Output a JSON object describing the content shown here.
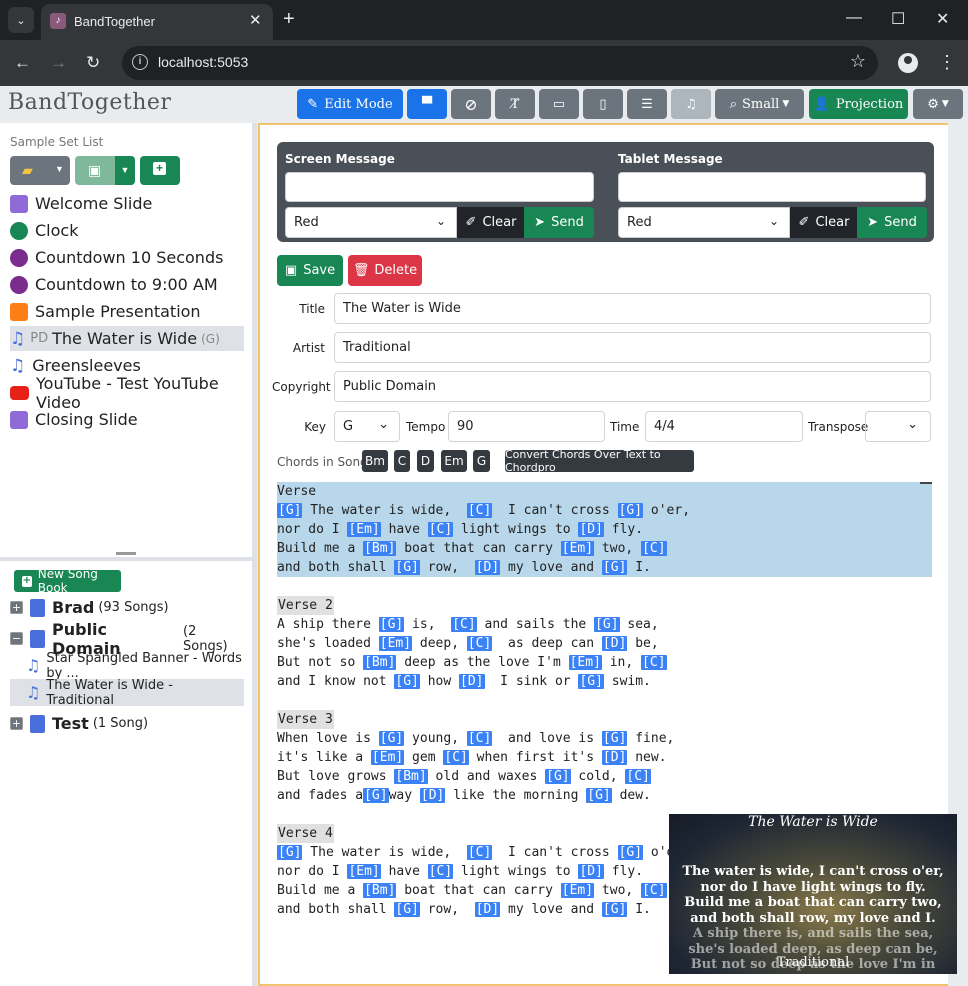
{
  "browser": {
    "tab_title": "BandTogether",
    "url": "localhost:5053"
  },
  "app": {
    "brand": "BandTogether",
    "toolbar": {
      "edit_mode": "Edit Mode",
      "search_size": "Small",
      "projection": "Projection"
    }
  },
  "sidebar": {
    "set_list_label": "Sample Set List",
    "slides": [
      {
        "label": "Welcome Slide",
        "icon": "image-icon",
        "color": "#8e6bd6"
      },
      {
        "label": "Clock",
        "icon": "clock-icon",
        "color": "#198754"
      },
      {
        "label": "Countdown 10 Seconds",
        "icon": "stopwatch-icon",
        "color": "#7b2d8e"
      },
      {
        "label": "Countdown to 9:00 AM",
        "icon": "stopwatch-icon",
        "color": "#7b2d8e"
      },
      {
        "label": "Sample Presentation",
        "icon": "presentation-icon",
        "color": "#fd7e14"
      },
      {
        "label": "The Water is Wide",
        "prefix": "PD",
        "suffix": "(G)",
        "icon": "music-icon",
        "color": "#4a6fdc"
      },
      {
        "label": "Greensleeves",
        "icon": "music-icon",
        "color": "#4a6fdc"
      },
      {
        "label": "YouTube - Test YouTube Video",
        "icon": "youtube-icon",
        "color": "#e62117"
      },
      {
        "label": "Closing Slide",
        "icon": "image-icon",
        "color": "#8e6bd6"
      }
    ],
    "new_song_book": "New Song Book",
    "books": [
      {
        "name": "Brad",
        "count": "(93 Songs)",
        "toggle": "+"
      },
      {
        "name": "Public Domain",
        "count": "(2 Songs)",
        "toggle": "−"
      },
      {
        "name": "Test",
        "count": "(1 Song)",
        "toggle": "+"
      }
    ],
    "songs": [
      "Star Spangled Banner - Words by ...",
      "The Water is Wide - Traditional"
    ]
  },
  "messages": {
    "screen_label": "Screen Message",
    "tablet_label": "Tablet Message",
    "screen_color": "Red",
    "tablet_color": "Red",
    "clear": "Clear",
    "send": "Send"
  },
  "song_form": {
    "save": "Save",
    "delete": "Delete",
    "title_label": "Title",
    "title": "The Water is Wide",
    "artist_label": "Artist",
    "artist": "Traditional",
    "copyright_label": "Copyright",
    "copyright": "Public Domain",
    "key_label": "Key",
    "key": "G",
    "tempo_label": "Tempo",
    "tempo": "90",
    "time_label": "Time",
    "time": "4/4",
    "transpose_label": "Transpose",
    "transpose": ""
  },
  "chords": {
    "label": "Chords in Song:",
    "list": [
      "Bm",
      "C",
      "D",
      "Em",
      "G"
    ],
    "convert": "Convert Chords Over Text to Chordpro"
  },
  "lyrics": {
    "verse1": "Verse",
    "verse2": "Verse 2",
    "verse3": "Verse 3",
    "verse4": "Verse 4"
  },
  "preview": {
    "title": "The Water is Wide",
    "lines": [
      "The water is wide, I can't cross o'er,",
      "nor do I have light wings to fly.",
      "Build me a boat that can carry two,",
      "and both shall row, my love and I.",
      "A ship there is, and sails the sea,",
      "she's loaded deep, as deep can be,",
      "But not so deep as the love I'm in"
    ],
    "footer": "Traditional"
  },
  "colors": {
    "primary": "#1a73e8",
    "success": "#198754",
    "danger": "#dc3545",
    "chord": "#3b82f6",
    "highlight": "#b8d7ea"
  }
}
